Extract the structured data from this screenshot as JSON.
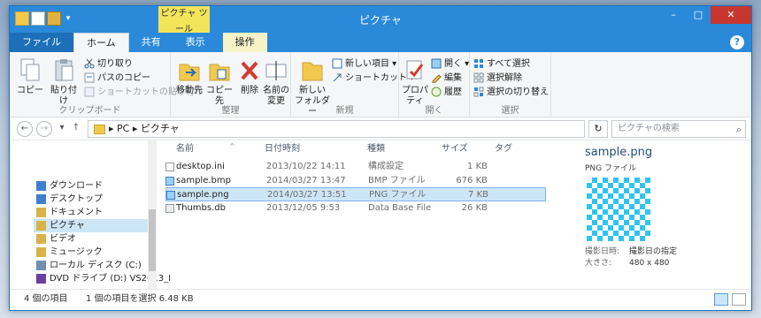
{
  "window": {
    "title": "ピクチャ",
    "contextual_group": "ピクチャ ツール",
    "controls": [
      "–",
      "□",
      "✕"
    ]
  },
  "tabs": [
    "ファイル",
    "ホーム",
    "共有",
    "表示",
    "操作"
  ],
  "ribbon": {
    "clipboard": {
      "label": "クリップボード",
      "copy": "コピー",
      "paste": "貼り付け",
      "cut": "切り取り",
      "copy_path": "パスのコピー",
      "paste_shortcut": "ショートカットの貼り付け"
    },
    "organize": {
      "label": "整理",
      "move_to": "移動先",
      "copy_to": "コピー先",
      "delete": "削除",
      "rename_1": "名前の",
      "rename_2": "変更"
    },
    "new": {
      "label": "新規",
      "new_folder_1": "新しい",
      "new_folder_2": "フォルダー",
      "new_item": "新しい項目 ▾",
      "shortcut": "ショートカット ▾"
    },
    "open": {
      "label": "開く",
      "properties": "プロパティ",
      "open": "開く ▾",
      "edit": "編集",
      "history": "履歴"
    },
    "select": {
      "label": "選択",
      "select_all": "すべて選択",
      "select_none": "選択解除",
      "invert": "選択の切り替え"
    }
  },
  "address": {
    "back": "←",
    "forward": "→",
    "recent": "▾",
    "up": "↑",
    "path": "▸ PC ▸ ピクチャ",
    "refresh": "↻",
    "search_placeholder": "ピクチャの検索",
    "search_icon": "⌕"
  },
  "nav": {
    "items": [
      {
        "label": "ダウンロード",
        "color": "#3f7fd0"
      },
      {
        "label": "デスクトップ",
        "color": "#3f7fd0"
      },
      {
        "label": "ドキュメント",
        "color": "#d9b24a"
      },
      {
        "label": "ピクチャ",
        "color": "#d9b24a"
      },
      {
        "label": "ビデオ",
        "color": "#d9b24a"
      },
      {
        "label": "ミュージック",
        "color": "#d9b24a"
      },
      {
        "label": "ローカル ディスク (C:)",
        "color": "#6f8fb0"
      },
      {
        "label": "DVD ドライブ (D:) VS2013_I",
        "color": "#6b3fa0"
      }
    ]
  },
  "columns": {
    "name": "名前",
    "date": "日付時刻",
    "type": "種類",
    "size": "サイズ",
    "tag": "タグ",
    "sort_indicator": "^"
  },
  "files": [
    {
      "name": "desktop.ini",
      "date": "2013/10/22 14:11",
      "type": "構成設定",
      "size": "1 KB",
      "icon": "ini"
    },
    {
      "name": "sample.bmp",
      "date": "2014/03/27 13:47",
      "type": "BMP ファイル",
      "size": "676 KB",
      "icon": "img"
    },
    {
      "name": "sample.png",
      "date": "2014/03/27 13:51",
      "type": "PNG ファイル",
      "size": "7 KB",
      "icon": "img"
    },
    {
      "name": "Thumbs.db",
      "date": "2013/12/05 9:53",
      "type": "Data Base File",
      "size": "26 KB",
      "icon": "db"
    }
  ],
  "preview": {
    "title": "sample.png",
    "type": "PNG ファイル",
    "date_key": "撮影日時:",
    "date_val": "撮影日の指定",
    "size_key": "大きさ:",
    "size_val": "480 x 480"
  },
  "status": {
    "count": "4 個の項目",
    "selected": "1 個の項目を選択 6.48 KB"
  }
}
